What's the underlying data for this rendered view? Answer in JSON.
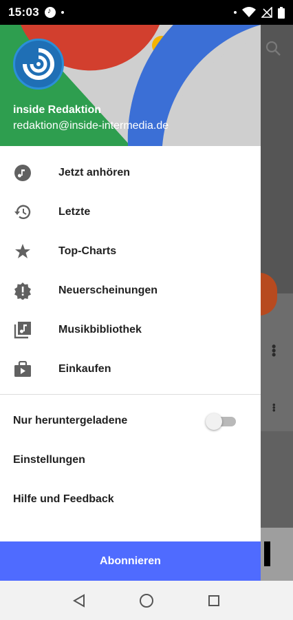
{
  "status_bar": {
    "time": "15:03"
  },
  "account": {
    "name": "inside Redaktion",
    "email": "redaktion@inside-intermedia.de"
  },
  "menu": {
    "items": [
      {
        "label": "Jetzt anhören",
        "icon": "music-note-icon"
      },
      {
        "label": "Letzte",
        "icon": "history-icon"
      },
      {
        "label": "Top-Charts",
        "icon": "star-icon"
      },
      {
        "label": "Neuerscheinungen",
        "icon": "new-releases-icon"
      },
      {
        "label": "Musikbibliothek",
        "icon": "music-library-icon"
      },
      {
        "label": "Einkaufen",
        "icon": "shop-icon"
      }
    ]
  },
  "settings": {
    "downloaded_only": "Nur heruntergeladene",
    "downloaded_only_enabled": false,
    "settings_label": "Einstellungen",
    "help_label": "Hilfe und Feedback"
  },
  "subscribe_label": "Abonnieren",
  "colors": {
    "accent": "#4f6bff",
    "header_green": "#2e9e4f",
    "header_red": "#d23f2e",
    "header_blue": "#3b6fd6",
    "header_yellow": "#f4b400"
  }
}
